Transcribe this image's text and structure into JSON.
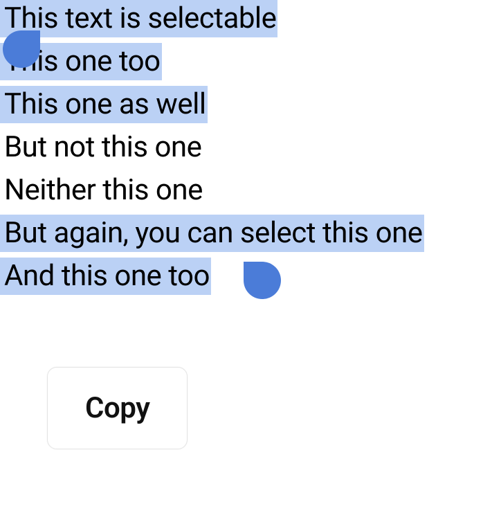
{
  "text": {
    "lines": [
      {
        "text": "This text is selectable",
        "selected": true
      },
      {
        "text": "This one too",
        "selected": true
      },
      {
        "text": "This one as well",
        "selected": true
      },
      {
        "text": "But not this one",
        "selected": false
      },
      {
        "text": "Neither this one",
        "selected": false
      },
      {
        "text": "But again, you can select this one",
        "selected": true
      },
      {
        "text": "And this one too",
        "selected": true
      }
    ]
  },
  "popup": {
    "copy_label": "Copy"
  },
  "colors": {
    "selection_bg": "#bbd1f5",
    "handle": "#4b7cd8",
    "text": "#000000",
    "bg": "#ffffff"
  }
}
